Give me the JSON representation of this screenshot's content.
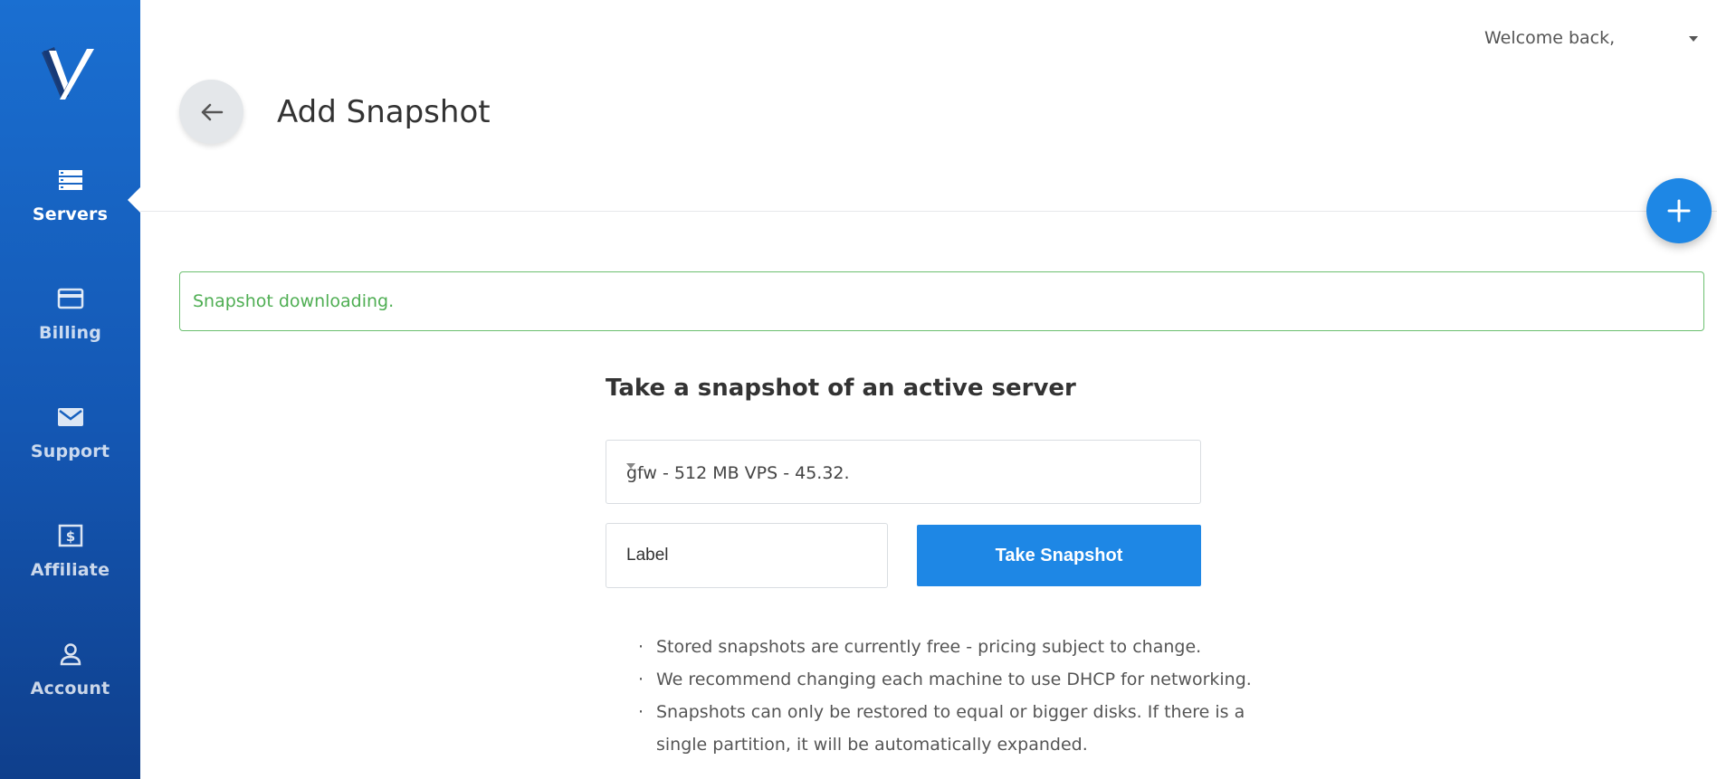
{
  "sidebar": {
    "logo": "vultr-logo",
    "items": [
      {
        "label": "Servers",
        "icon": "servers-icon",
        "active": true
      },
      {
        "label": "Billing",
        "icon": "credit-card-icon",
        "active": false
      },
      {
        "label": "Support",
        "icon": "envelope-icon",
        "active": false
      },
      {
        "label": "Affiliate",
        "icon": "dollar-bill-icon",
        "active": false
      },
      {
        "label": "Account",
        "icon": "user-icon",
        "active": false
      }
    ]
  },
  "header": {
    "welcome": "Welcome back,",
    "title": "Add Snapshot"
  },
  "alert": {
    "message": "Snapshot downloading.",
    "color": "#4fae53"
  },
  "form": {
    "section_title": "Take a snapshot of an active server",
    "server_selected": "gfw - 512 MB VPS - 45.32.",
    "label_placeholder": "Label",
    "submit_label": "Take Snapshot"
  },
  "notes": [
    "Stored snapshots are currently free - pricing subject to change.",
    "We recommend changing each machine to use DHCP for networking.",
    "Snapshots can only be restored to equal or bigger disks. If there is a single partition, it will be automatically expanded."
  ],
  "colors": {
    "sidebar": "#1a6fd1",
    "accent": "#1e87e5",
    "success": "#6cc070"
  }
}
